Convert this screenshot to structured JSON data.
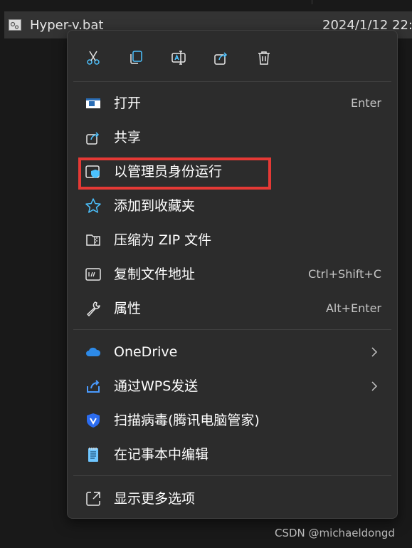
{
  "file": {
    "name": "Hyper-v.bat",
    "date": "2024/1/12 22:"
  },
  "toolbar": {
    "items": [
      {
        "name": "cut",
        "icon": "scissors-icon"
      },
      {
        "name": "copy",
        "icon": "copy-icon"
      },
      {
        "name": "rename",
        "icon": "rename-icon"
      },
      {
        "name": "share",
        "icon": "share-icon"
      },
      {
        "name": "delete",
        "icon": "trash-icon"
      }
    ]
  },
  "menu": {
    "open": {
      "label": "打开",
      "shortcut": "Enter",
      "icon": "open-window-icon"
    },
    "share": {
      "label": "共享",
      "icon": "share-icon"
    },
    "run_as_admin": {
      "label": "以管理员身份运行",
      "icon": "shield-icon"
    },
    "add_favorite": {
      "label": "添加到收藏夹",
      "icon": "star-icon"
    },
    "compress_zip": {
      "label": "压缩为 ZIP 文件",
      "icon": "zip-folder-icon"
    },
    "copy_path": {
      "label": "复制文件地址",
      "shortcut": "Ctrl+Shift+C",
      "icon": "path-icon"
    },
    "properties": {
      "label": "属性",
      "shortcut": "Alt+Enter",
      "icon": "wrench-icon"
    },
    "onedrive": {
      "label": "OneDrive",
      "icon": "cloud-icon"
    },
    "wps_send": {
      "label": "通过WPS发送",
      "icon": "send-icon"
    },
    "virus_scan": {
      "label": "扫描病毒(腾讯电脑管家)",
      "icon": "shield-v-icon"
    },
    "notepad_edit": {
      "label": "在记事本中编辑",
      "icon": "notepad-icon"
    },
    "show_more": {
      "label": "显示更多选项",
      "icon": "expand-icon"
    }
  },
  "colors": {
    "accent_blue": "#4cc2ff",
    "highlight_red": "#e53935",
    "menu_bg": "#2c2c2c"
  },
  "watermark": "CSDN @michaeldongd"
}
